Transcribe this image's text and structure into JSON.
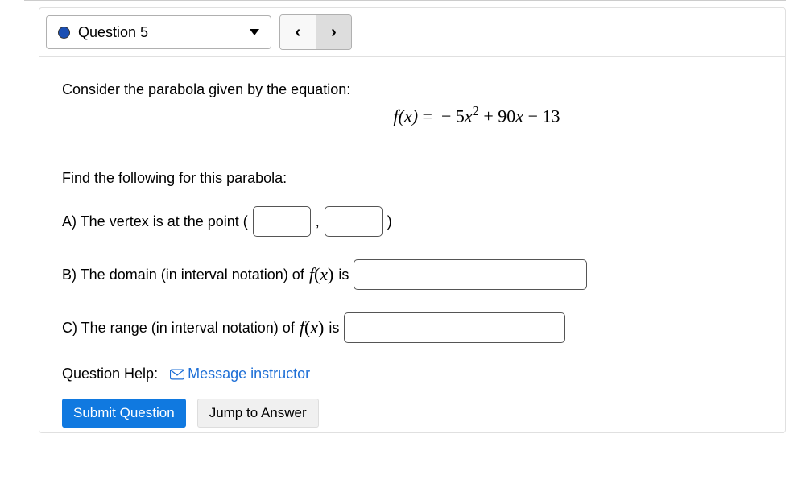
{
  "header": {
    "question_label": "Question 5",
    "prev_glyph": "‹",
    "next_glyph": "›"
  },
  "body": {
    "intro": "Consider the parabola given by the equation:",
    "equation_lhs": "f(x)",
    "equation_rhs_prefix": " =  − 5",
    "equation_rhs_var": "x",
    "equation_rhs_mid": " + 90",
    "equation_rhs_tail": " − 13",
    "find": "Find the following for this parabola:",
    "partA_pre": "A) The vertex is at the point (",
    "partA_comma": ",",
    "partA_close": ")",
    "partB_pre": "B) The domain (in interval notation) of ",
    "partB_fx": "f(x)",
    "partB_post": " is",
    "partC_pre": "C) The range (in interval notation) of ",
    "partC_fx": "f(x)",
    "partC_post": " is",
    "help_label": "Question Help:",
    "msg_link": "Message instructor",
    "submit": "Submit Question",
    "jump": "Jump to Answer"
  },
  "inputs": {
    "vertex_x": "",
    "vertex_y": "",
    "domain": "",
    "range": ""
  }
}
